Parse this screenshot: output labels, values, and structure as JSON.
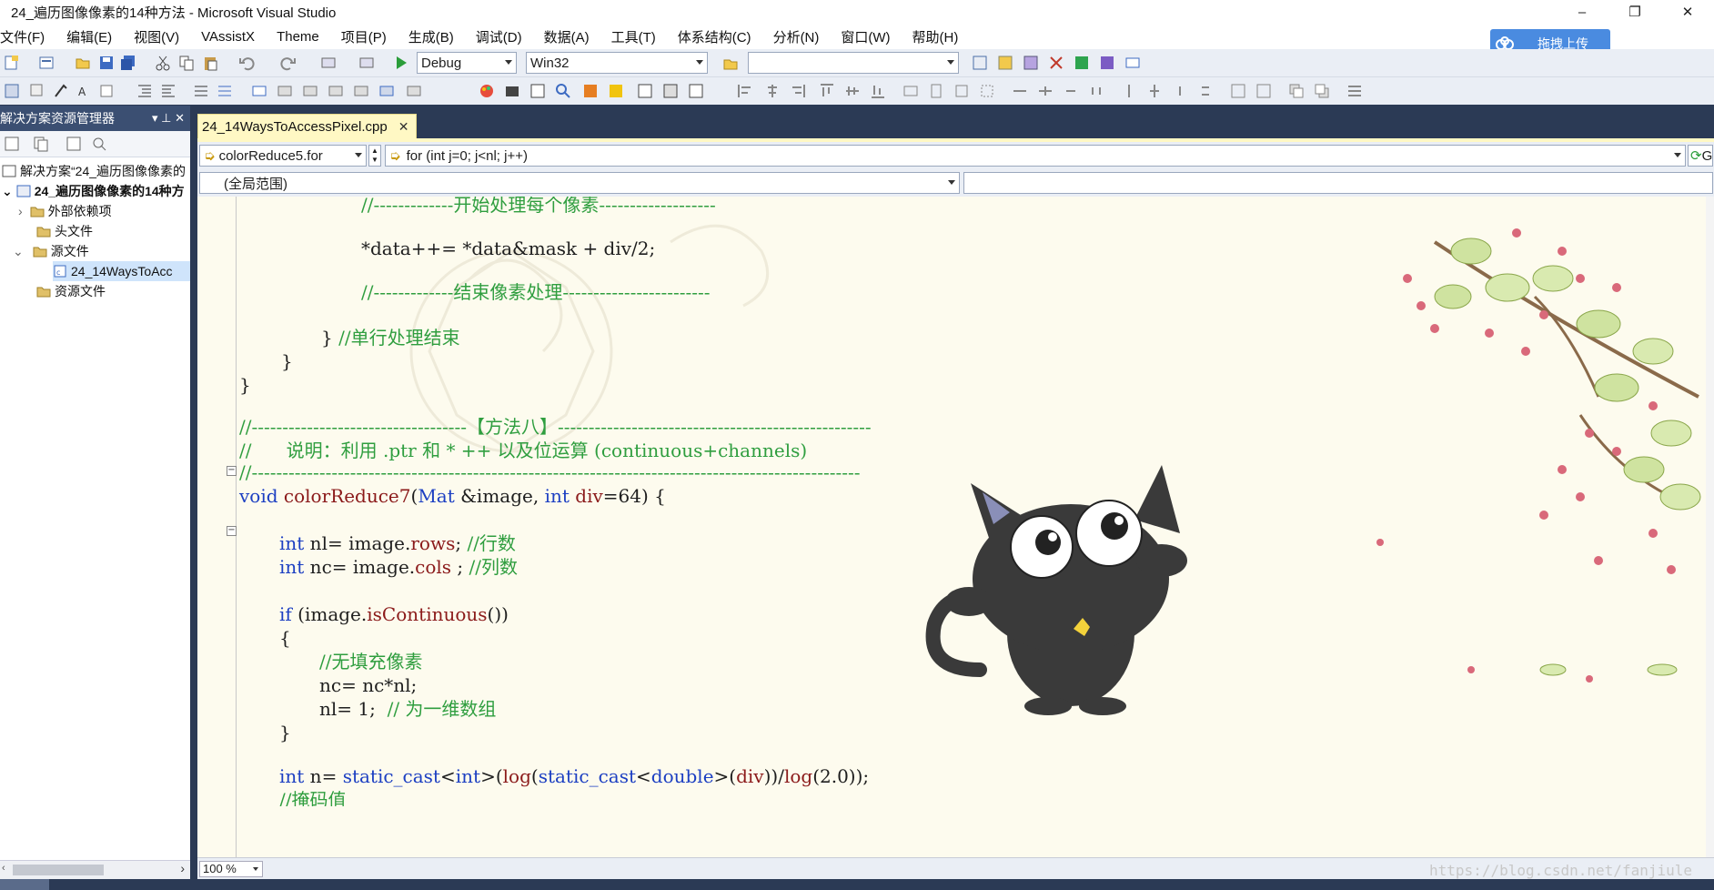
{
  "window": {
    "title": "24_遍历图像像素的14种方法 - Microsoft Visual Studio",
    "controls": {
      "minimize": "–",
      "restore": "❐",
      "close": "✕"
    }
  },
  "menu": [
    "文件(F)",
    "编辑(E)",
    "视图(V)",
    "VAssistX",
    "Theme",
    "项目(P)",
    "生成(B)",
    "调试(D)",
    "数据(A)",
    "工具(T)",
    "体系结构(C)",
    "分析(N)",
    "窗口(W)",
    "帮助(H)"
  ],
  "upload_button": {
    "label": "拖拽上传",
    "color": "#4a8be0"
  },
  "toolbar": {
    "configuration": "Debug",
    "platform": "Win32",
    "find_combo": ""
  },
  "solution_explorer": {
    "title": "解决方案资源管理器",
    "pin": "▾ ⊥ ✕",
    "nodes": [
      {
        "label": "解决方案“24_遍历图像像素的",
        "icon": "solution-icon"
      },
      {
        "label": "24_遍历图像像素的14种方",
        "icon": "project-icon"
      },
      {
        "label": "外部依赖项",
        "icon": "folder-icon"
      },
      {
        "label": "头文件",
        "icon": "folder-icon"
      },
      {
        "label": "源文件",
        "icon": "folder-icon"
      },
      {
        "label": "24_14WaysToAcc",
        "icon": "cpp-file-icon"
      },
      {
        "label": "资源文件",
        "icon": "folder-icon"
      }
    ]
  },
  "editor": {
    "tab_label": "24_14WaysToAccessPixel.cpp",
    "tab_close": "✕",
    "nav_scope": "colorReduce5.for",
    "nav_member": "for (int j=0; j<nl; j++)",
    "nav_go": "G",
    "global_scope": "(全局范围)",
    "zoom": "100 %",
    "watermark": "https://blog.csdn.net/fanjiule",
    "code_lines": [
      "//-------------开始处理每个像素-------------------",
      "",
      "*data++= *data&mask + div/2;",
      "",
      "//-------------结束像素处理------------------------",
      "",
      "} //单行处理结束",
      "}",
      "}",
      "",
      "//-----------------------------------【方法八】---------------------------------------------------",
      "//      说明：利用 .ptr 和 * ++ 以及位运算 (continuous+channels)",
      "//---------------------------------------------------------------------------------------------------",
      "void colorReduce7(Mat &image, int div=64) {",
      "",
      "int nl= image.rows; //行数",
      "int nc= image.cols ; //列数",
      "",
      "if (image.isContinuous())",
      "{",
      "//无填充像素",
      "nc= nc*nl;",
      "nl= 1;  // 为一维数组",
      "}",
      "",
      "int n= static_cast<int>(log(static_cast<double>(div))/log(2.0));",
      "//掩码值"
    ]
  }
}
